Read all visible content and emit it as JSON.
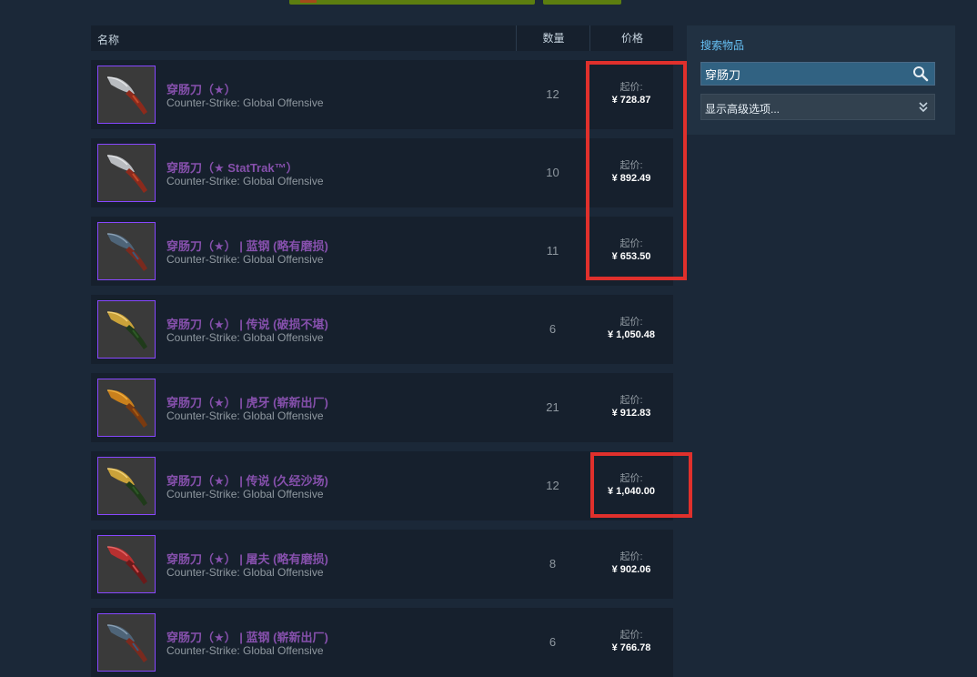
{
  "header": {
    "name": "名称",
    "qty": "数量",
    "price": "价格"
  },
  "price_label": "起价:",
  "game": "Counter-Strike: Global Offensive",
  "items": [
    {
      "name": "穿肠刀（★）",
      "qty": "12",
      "price": "¥ 728.87",
      "skin": "crimson"
    },
    {
      "name": "穿肠刀（★ StatTrak™）",
      "qty": "10",
      "price": "¥ 892.49",
      "skin": "crimson"
    },
    {
      "name": "穿肠刀（★） | 蓝钢 (略有磨损)",
      "qty": "11",
      "price": "¥ 653.50",
      "skin": "blue-steel"
    },
    {
      "name": "穿肠刀（★） | 传说 (破损不堪)",
      "qty": "6",
      "price": "¥ 1,050.48",
      "skin": "lore"
    },
    {
      "name": "穿肠刀（★） | 虎牙 (崭新出厂)",
      "qty": "21",
      "price": "¥ 912.83",
      "skin": "tiger-tooth"
    },
    {
      "name": "穿肠刀（★） | 传说 (久经沙场)",
      "qty": "12",
      "price": "¥ 1,040.00",
      "skin": "lore"
    },
    {
      "name": "穿肠刀（★） | 屠夫 (略有磨损)",
      "qty": "8",
      "price": "¥ 902.06",
      "skin": "slaughter"
    },
    {
      "name": "穿肠刀（★） | 蓝钢 (崭新出厂)",
      "qty": "6",
      "price": "¥ 766.78",
      "skin": "blue-steel"
    }
  ],
  "sidebar": {
    "title": "搜索物品",
    "search_value": "穿肠刀",
    "advanced_label": "显示高级选项..."
  },
  "colors": {
    "background": "#1b2838",
    "row": "#16202d",
    "item_name": "#8650ac",
    "rarity_border": "#8847ff",
    "highlight": "#e0302c",
    "accent": "#66c0f4"
  },
  "icons": {
    "search": "magnifier-icon",
    "advanced": "double-chevron-down-icon"
  }
}
